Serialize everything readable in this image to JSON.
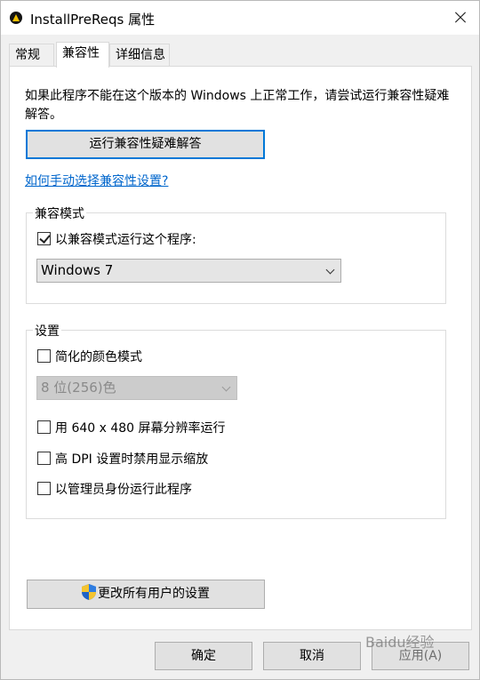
{
  "window": {
    "title": "InstallPreReqs 属性",
    "close_icon": "close-icon"
  },
  "tabs": [
    {
      "label": "常规",
      "active": false
    },
    {
      "label": "兼容性",
      "active": true
    },
    {
      "label": "详细信息",
      "active": false
    }
  ],
  "compat": {
    "description": "如果此程序不能在这个版本的 Windows 上正常工作，请尝试运行兼容性疑难解答。",
    "troubleshoot_button": "运行兼容性疑难解答",
    "manual_link": "如何手动选择兼容性设置?"
  },
  "mode_group": {
    "label": "兼容模式",
    "checkbox_label": "以兼容模式运行这个程序:",
    "checked": true,
    "select_value": "Windows 7"
  },
  "settings_group": {
    "label": "设置",
    "reduced_color": {
      "label": "简化的颜色模式",
      "checked": false
    },
    "color_select_value": "8 位(256)色",
    "res_640": {
      "label": "用 640 x 480 屏幕分辨率运行",
      "checked": false
    },
    "dpi_scaling": {
      "label": "高 DPI 设置时禁用显示缩放",
      "checked": false
    },
    "run_as_admin": {
      "label": "以管理员身份运行此程序",
      "checked": false
    }
  },
  "change_all_users_button": "更改所有用户的设置",
  "footer": {
    "ok": "确定",
    "cancel": "取消",
    "apply": "应用(A)"
  },
  "watermark": "Baidu经验",
  "colors": {
    "accent": "#0078d7",
    "link": "#0066cc"
  }
}
